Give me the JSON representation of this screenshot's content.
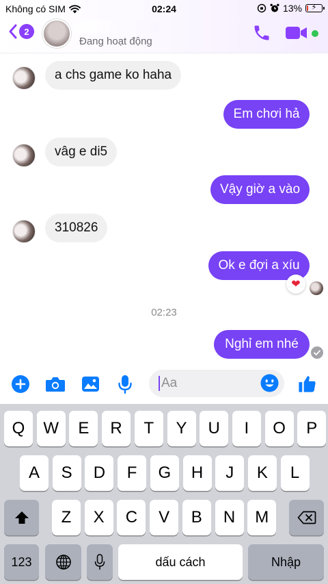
{
  "status_bar": {
    "carrier": "Không có SIM",
    "time": "02:24",
    "battery": "13%",
    "battery_level": 0.13
  },
  "header": {
    "unread_count": "2",
    "activity_status": "Đang hoạt động",
    "colors": {
      "accent": "#8a3ffc",
      "online": "#31c755"
    }
  },
  "messages": [
    {
      "side": "in",
      "text": "a chs game ko haha"
    },
    {
      "side": "out",
      "text": "Em chơi hả"
    },
    {
      "side": "in",
      "text": "vâg e di5"
    },
    {
      "side": "out",
      "text": "Vậy giờ a vào"
    },
    {
      "side": "in",
      "text": "310826"
    },
    {
      "side": "out",
      "text": "Ok e đợi a xíu",
      "reaction": "heart"
    },
    {
      "side": "out",
      "text": "Nghỉ em nhé"
    }
  ],
  "timestamp_separator": "02:23",
  "bubble_colors": {
    "incoming": "#f0f0f0",
    "outgoing": "#7842f5"
  },
  "composer": {
    "placeholder": "Aa",
    "icons": [
      "plus-icon",
      "camera-icon",
      "gallery-icon",
      "microphone-icon",
      "emoji-icon",
      "thumbs-up-icon"
    ]
  },
  "keyboard": {
    "row1": [
      "Q",
      "W",
      "E",
      "R",
      "T",
      "Y",
      "U",
      "I",
      "O",
      "P"
    ],
    "row2": [
      "A",
      "S",
      "D",
      "F",
      "G",
      "H",
      "J",
      "K",
      "L"
    ],
    "row3": [
      "Z",
      "X",
      "C",
      "V",
      "B",
      "N",
      "M"
    ],
    "numbers_key": "123",
    "space_key": "dấu cách",
    "return_key": "Nhập"
  }
}
